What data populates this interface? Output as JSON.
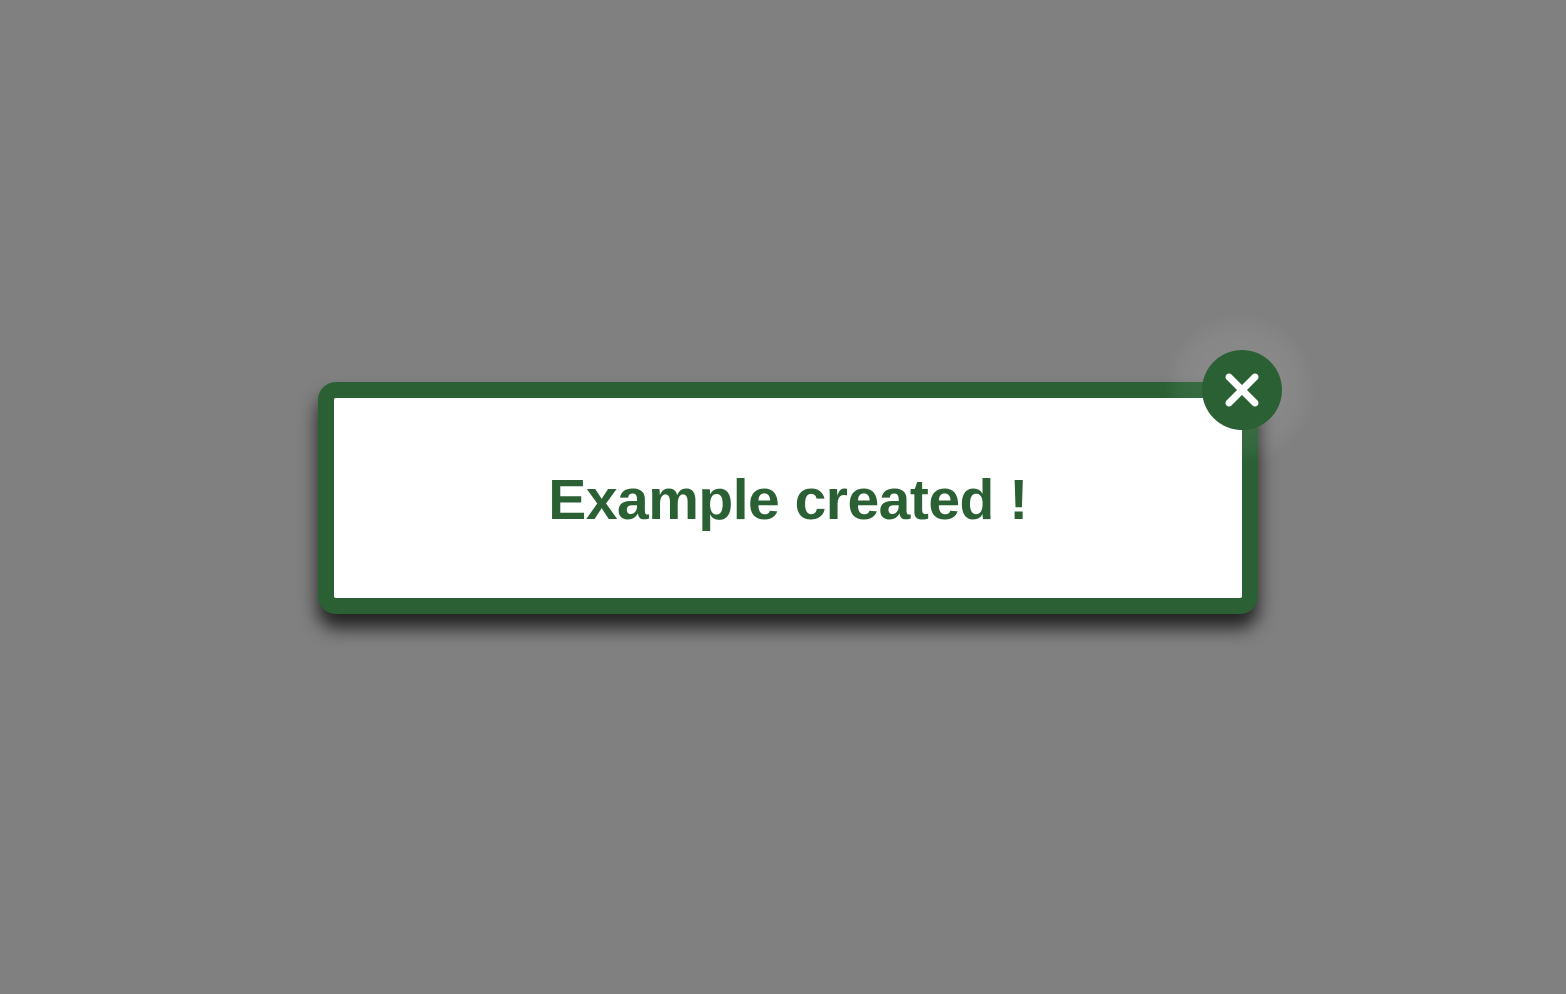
{
  "toast": {
    "message": "Example created !",
    "accent_color": "#2a6034",
    "background_color": "#ffffff"
  },
  "overlay": {
    "color": "#808080"
  },
  "close_button": {
    "icon": "close-icon"
  }
}
